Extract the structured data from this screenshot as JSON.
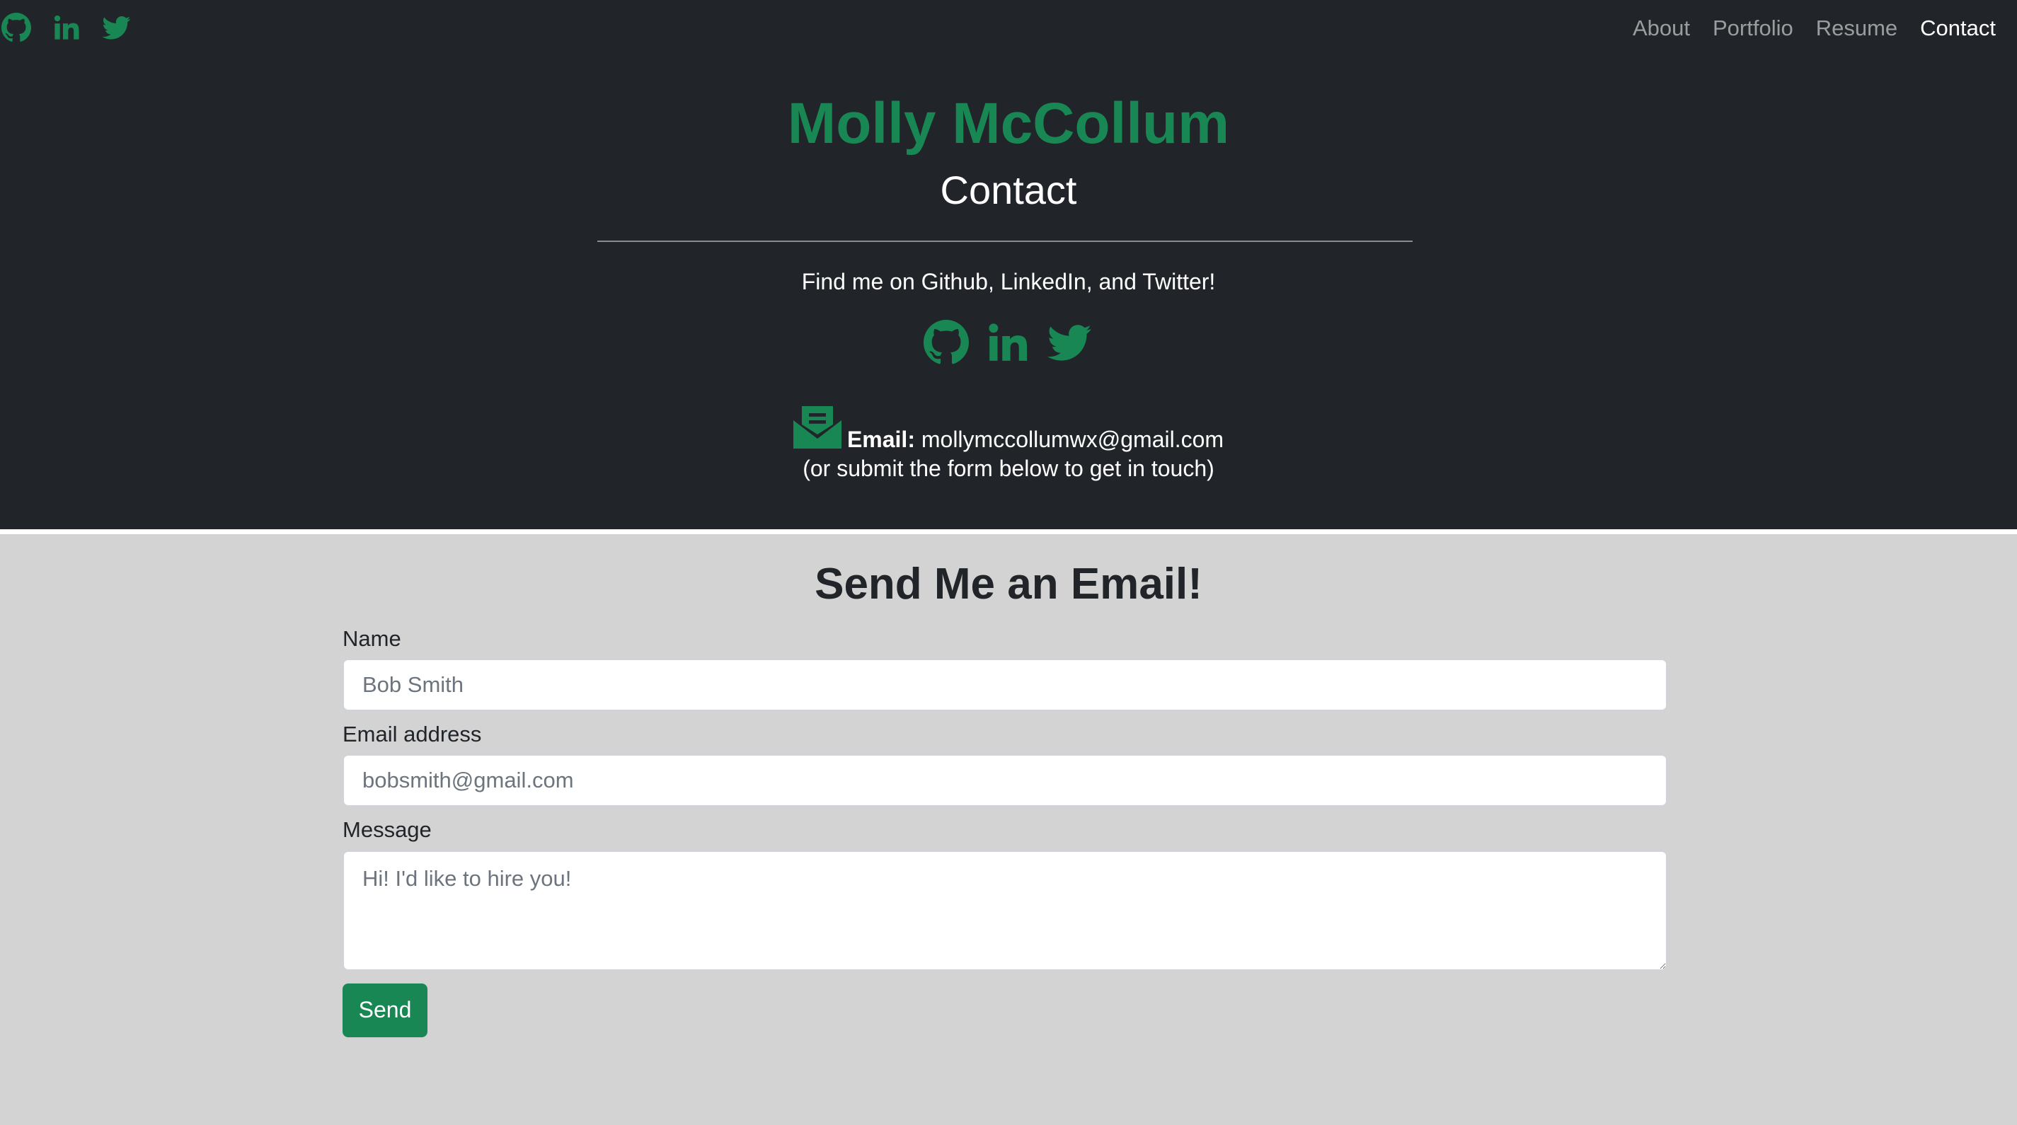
{
  "nav": {
    "social_icons": [
      "github-icon",
      "linkedin-icon",
      "twitter-icon"
    ],
    "links": [
      {
        "label": "About",
        "active": false
      },
      {
        "label": "Portfolio",
        "active": false
      },
      {
        "label": "Resume",
        "active": false
      },
      {
        "label": "Contact",
        "active": true
      }
    ]
  },
  "header": {
    "name": "Molly McCollum",
    "page_title": "Contact",
    "social_prompt": "Find me on Github, LinkedIn, and Twitter!",
    "social_icons": [
      "github-icon",
      "linkedin-icon",
      "twitter-icon"
    ],
    "email_icon": "envelope-open-text-icon",
    "email_label": "Email:",
    "email_address": "mollymccollumwx@gmail.com",
    "email_note": "(or submit the form below to get in touch)"
  },
  "form": {
    "title": "Send Me an Email!",
    "name_label": "Name",
    "name_placeholder": "Bob Smith",
    "email_label": "Email address",
    "email_placeholder": "bobsmith@gmail.com",
    "message_label": "Message",
    "message_placeholder": "Hi! I'd like to hire you!",
    "send_label": "Send"
  },
  "colors": {
    "dark_background": "#212529",
    "accent_green": "#198754",
    "page_background": "#d3d3d3",
    "nav_inactive": "rgba(255,255,255,0.55)",
    "nav_active": "#ffffff"
  }
}
